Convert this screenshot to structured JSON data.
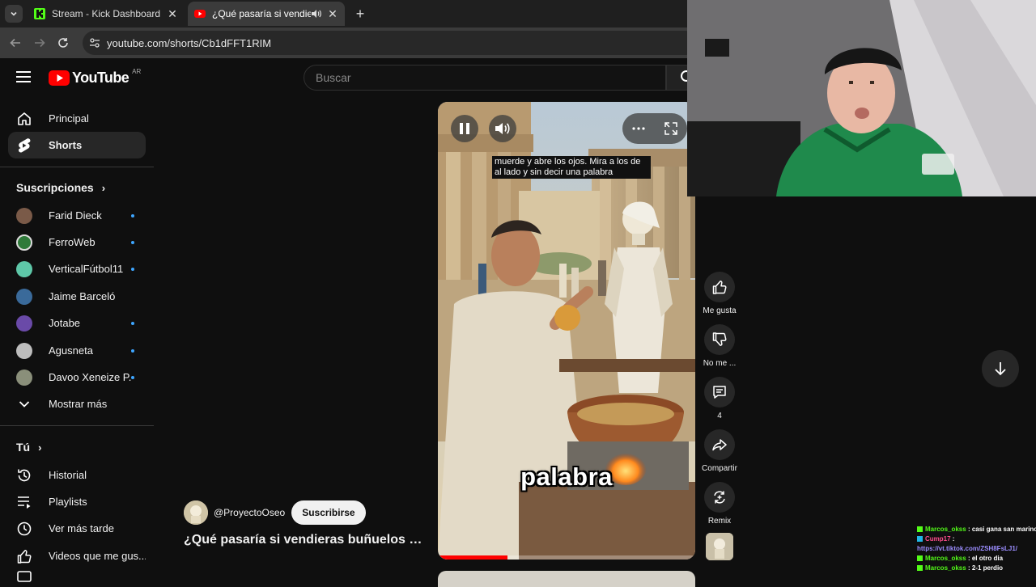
{
  "browser": {
    "tabs": [
      {
        "title": "Stream - Kick Dashboard",
        "favicon": "kick-icon",
        "active": false
      },
      {
        "title": "¿Qué pasaría si vendieras b",
        "favicon": "youtube-icon",
        "active": true
      }
    ],
    "url": "youtube.com/shorts/Cb1dFFT1RIM"
  },
  "header": {
    "logo_text": "YouTube",
    "country_code": "AR",
    "search_placeholder": "Buscar"
  },
  "sidebar": {
    "main": [
      {
        "label": "Principal",
        "icon": "home-icon"
      },
      {
        "label": "Shorts",
        "icon": "shorts-icon",
        "active": true
      }
    ],
    "subscriptions_title": "Suscripciones",
    "subscriptions": [
      {
        "label": "Farid Dieck",
        "color": "#7a5a48"
      },
      {
        "label": "FerroWeb",
        "color": "#2f7a3a"
      },
      {
        "label": "VerticalFútbol11",
        "color": "#5ec7a8"
      },
      {
        "label": "Jaime Barceló",
        "color": "#3a6a9a"
      },
      {
        "label": "Jotabe",
        "color": "#6a4aa8"
      },
      {
        "label": "Agusneta",
        "color": "#bdbdbd"
      },
      {
        "label": "Davoo Xeneize P...",
        "color": "#8a8f7a"
      }
    ],
    "show_more": "Mostrar más",
    "you_title": "Tú",
    "you": [
      {
        "label": "Historial",
        "icon": "history-icon"
      },
      {
        "label": "Playlists",
        "icon": "playlist-icon"
      },
      {
        "label": "Ver más tarde",
        "icon": "clock-icon"
      },
      {
        "label": "Videos que me gus...",
        "icon": "thumbs-up-icon"
      }
    ]
  },
  "short": {
    "subtitle": "muerde y abre los ojos. Mira a los de al lado y sin decir una palabra",
    "caption": "palabra",
    "progress": 0.27,
    "channel_handle": "@ProyectoOseo",
    "subscribe_label": "Suscribirse",
    "title": "¿Qué pasaría si vendieras buñuelos en..."
  },
  "actions": {
    "like": "Me gusta",
    "dislike": "No me ...",
    "comments": "4",
    "share": "Compartir",
    "remix": "Remix"
  },
  "chat": [
    {
      "user": "Marcos_okss",
      "msg": ": casi gana san marino"
    },
    {
      "user": "Cump17",
      "msg": ":",
      "link": "https://vt.tiktok.com/ZSH8FsLJ1/"
    },
    {
      "user": "Marcos_okss",
      "msg": ": el otro dia"
    },
    {
      "user": "Marcos_okss",
      "msg": ": 2-1 perdio"
    }
  ]
}
